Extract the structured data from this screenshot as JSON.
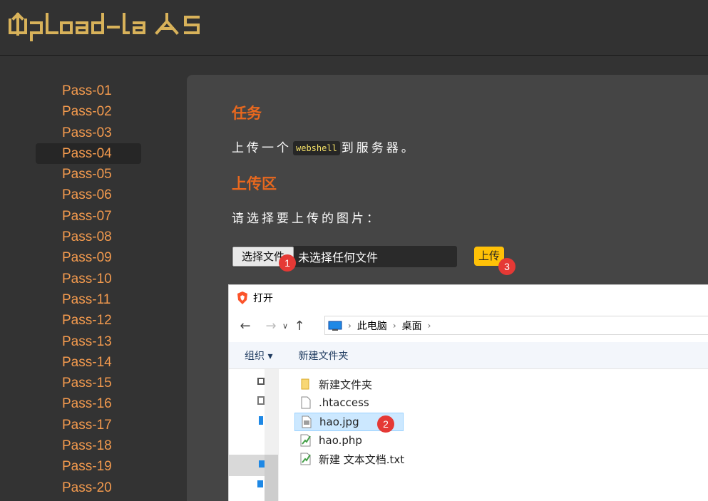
{
  "header": {
    "logo_text": "Upload-labs"
  },
  "sidebar": {
    "items": [
      {
        "label": "Pass-01"
      },
      {
        "label": "Pass-02"
      },
      {
        "label": "Pass-03"
      },
      {
        "label": "Pass-04"
      },
      {
        "label": "Pass-05"
      },
      {
        "label": "Pass-06"
      },
      {
        "label": "Pass-07"
      },
      {
        "label": "Pass-08"
      },
      {
        "label": "Pass-09"
      },
      {
        "label": "Pass-10"
      },
      {
        "label": "Pass-11"
      },
      {
        "label": "Pass-12"
      },
      {
        "label": "Pass-13"
      },
      {
        "label": "Pass-14"
      },
      {
        "label": "Pass-15"
      },
      {
        "label": "Pass-16"
      },
      {
        "label": "Pass-17"
      },
      {
        "label": "Pass-18"
      },
      {
        "label": "Pass-19"
      },
      {
        "label": "Pass-20"
      }
    ],
    "active_index": 3
  },
  "task": {
    "title": "任务",
    "text_before": "上传一个",
    "code": "webshell",
    "text_after": "到服务器。"
  },
  "upload": {
    "title": "上传区",
    "prompt": "请选择要上传的图片：",
    "choose_button": "选择文件",
    "file_status": "未选择任何文件",
    "submit_button": "上传"
  },
  "badges": {
    "one": "1",
    "two": "2",
    "three": "3"
  },
  "dialog": {
    "title": "打开",
    "breadcrumbs": [
      "此电脑",
      "桌面"
    ],
    "toolbar": {
      "organize": "组织 ▾",
      "new_folder": "新建文件夹"
    },
    "files": [
      {
        "name": "新建文件夹",
        "icon": "folder-icon"
      },
      {
        "name": ".htaccess",
        "icon": "file-icon"
      },
      {
        "name": "hao.jpg",
        "icon": "image-file-icon"
      },
      {
        "name": "hao.php",
        "icon": "php-file-icon"
      },
      {
        "name": "新建 文本文档.txt",
        "icon": "text-file-icon"
      }
    ],
    "selected_file": "hao.jpg"
  },
  "colors": {
    "accent": "#e8681e",
    "menu": "#f39a4e",
    "upload_button": "#ffc107",
    "badge": "#e53935",
    "code_text": "#f4e067"
  }
}
